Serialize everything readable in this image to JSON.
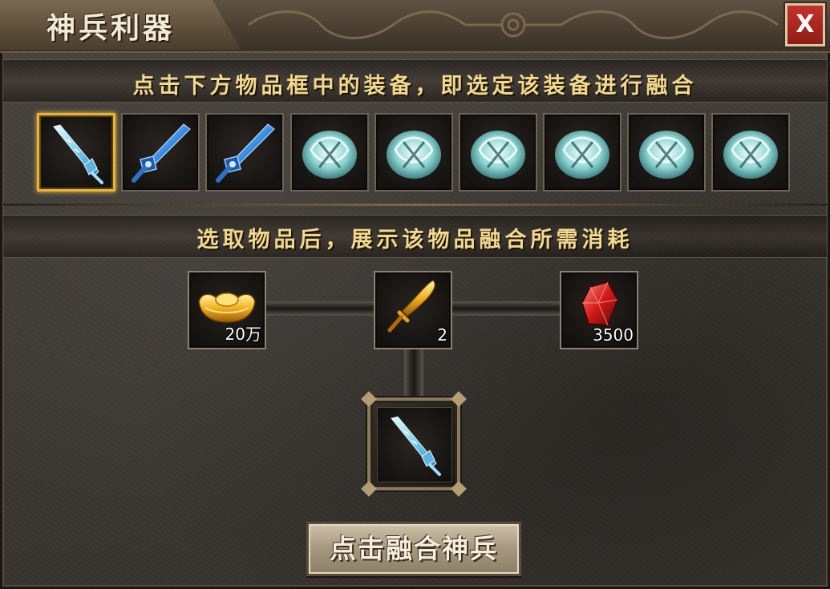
{
  "window": {
    "title": "神兵利器",
    "close_label": "X"
  },
  "instructions": {
    "select_hint": "点击下方物品框中的装备，即选定该装备进行融合",
    "cost_hint": "选取物品后，展示该物品融合所需消耗"
  },
  "equipment_slots": [
    {
      "icon": "ice-sword-icon",
      "selected": true
    },
    {
      "icon": "blue-sword-icon",
      "selected": false
    },
    {
      "icon": "blue-sword-icon",
      "selected": false
    },
    {
      "icon": "jade-ornament-icon",
      "selected": false
    },
    {
      "icon": "jade-ornament-icon",
      "selected": false
    },
    {
      "icon": "jade-ornament-icon",
      "selected": false
    },
    {
      "icon": "jade-ornament-icon",
      "selected": false
    },
    {
      "icon": "jade-ornament-icon",
      "selected": false
    },
    {
      "icon": "jade-ornament-icon",
      "selected": false
    }
  ],
  "materials": [
    {
      "icon": "gold-ingot-icon",
      "count": "20万"
    },
    {
      "icon": "golden-blade-icon",
      "count": "2"
    },
    {
      "icon": "red-crystal-icon",
      "count": "3500"
    }
  ],
  "result": {
    "icon": "ice-sword-icon"
  },
  "fuse_button": {
    "label": "点击融合神兵"
  },
  "colors": {
    "header_text": "#f2d98e",
    "selected_border": "#e7b43a",
    "close_button": "#b02a22"
  }
}
